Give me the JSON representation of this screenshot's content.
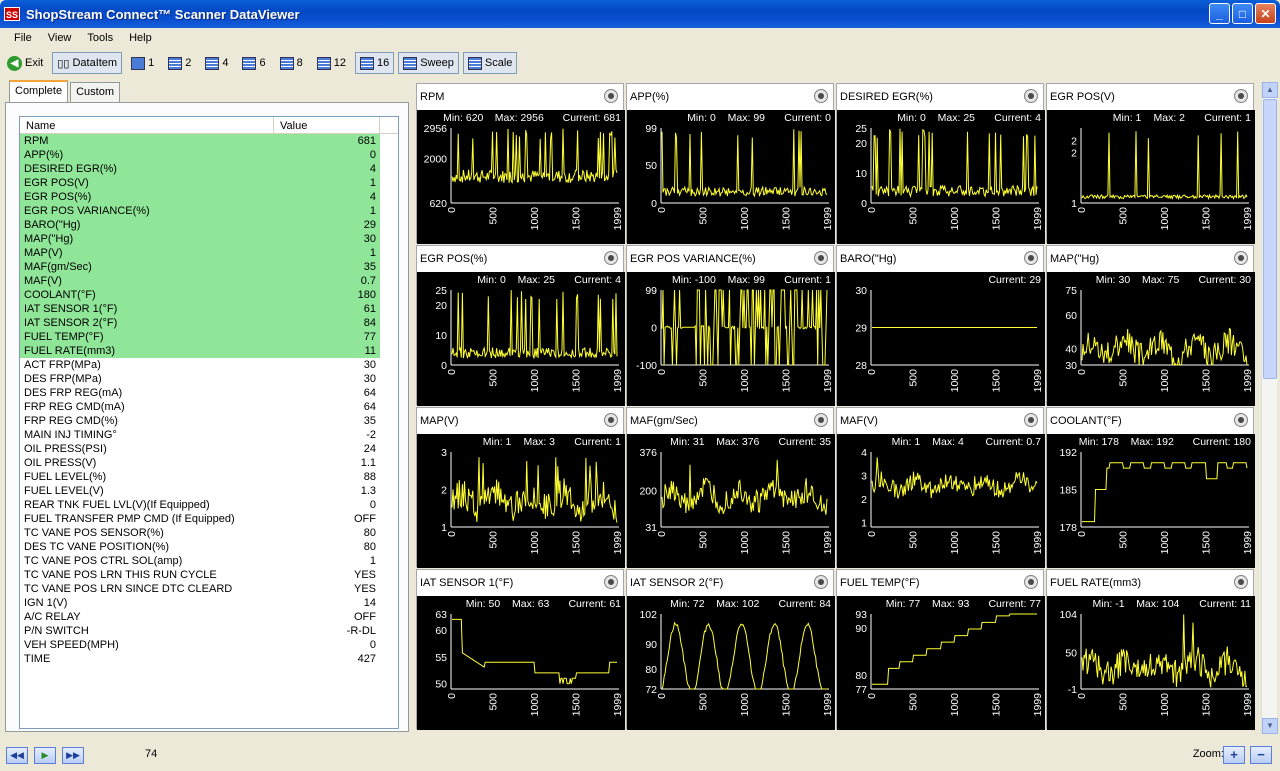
{
  "window": {
    "title": "ShopStream Connect™ Scanner DataViewer",
    "logo_text": "SS"
  },
  "menu": [
    "File",
    "View",
    "Tools",
    "Help"
  ],
  "toolbar": {
    "exit": "Exit",
    "dataitem": "DataItem",
    "layouts": [
      "1",
      "2",
      "4",
      "6",
      "8",
      "12",
      "16"
    ],
    "sweep": "Sweep",
    "scale": "Scale"
  },
  "tabs": [
    "Complete",
    "Custom"
  ],
  "list": {
    "col_name": "Name",
    "col_value": "Value",
    "rows": [
      {
        "name": "RPM",
        "value": "681",
        "hl": true
      },
      {
        "name": "APP(%)",
        "value": "0",
        "hl": true
      },
      {
        "name": "DESIRED EGR(%)",
        "value": "4",
        "hl": true
      },
      {
        "name": "EGR POS(V)",
        "value": "1",
        "hl": true
      },
      {
        "name": "EGR POS(%)",
        "value": "4",
        "hl": true
      },
      {
        "name": "EGR POS VARIANCE(%)",
        "value": "1",
        "hl": true
      },
      {
        "name": "BARO(\"Hg)",
        "value": "29",
        "hl": true
      },
      {
        "name": "MAP(\"Hg)",
        "value": "30",
        "hl": true
      },
      {
        "name": "MAP(V)",
        "value": "1",
        "hl": true
      },
      {
        "name": "MAF(gm/Sec)",
        "value": "35",
        "hl": true
      },
      {
        "name": "MAF(V)",
        "value": "0.7",
        "hl": true
      },
      {
        "name": "COOLANT(°F)",
        "value": "180",
        "hl": true
      },
      {
        "name": "IAT SENSOR 1(°F)",
        "value": "61",
        "hl": true
      },
      {
        "name": "IAT SENSOR 2(°F)",
        "value": "84",
        "hl": true
      },
      {
        "name": "FUEL TEMP(°F)",
        "value": "77",
        "hl": true
      },
      {
        "name": "FUEL RATE(mm3)",
        "value": "11",
        "hl": true
      },
      {
        "name": "ACT FRP(MPa)",
        "value": "30",
        "hl": false
      },
      {
        "name": "DES FRP(MPa)",
        "value": "30",
        "hl": false
      },
      {
        "name": "DES FRP REG(mA)",
        "value": "64",
        "hl": false
      },
      {
        "name": "FRP REG CMD(mA)",
        "value": "64",
        "hl": false
      },
      {
        "name": "FRP REG CMD(%)",
        "value": "35",
        "hl": false
      },
      {
        "name": "MAIN INJ TIMING°",
        "value": "-2",
        "hl": false
      },
      {
        "name": "OIL PRESS(PSI)",
        "value": "24",
        "hl": false
      },
      {
        "name": "OIL PRESS(V)",
        "value": "1.1",
        "hl": false
      },
      {
        "name": "FUEL LEVEL(%)",
        "value": "88",
        "hl": false
      },
      {
        "name": "FUEL LEVEL(V)",
        "value": "1.3",
        "hl": false
      },
      {
        "name": "REAR TNK FUEL LVL(V)(If Equipped)",
        "value": "0",
        "hl": false
      },
      {
        "name": "FUEL TRANSFER PMP CMD (If Equipped)",
        "value": "OFF",
        "hl": false
      },
      {
        "name": "TC VANE POS SENSOR(%)",
        "value": "80",
        "hl": false
      },
      {
        "name": "DES TC VANE POSITION(%)",
        "value": "80",
        "hl": false
      },
      {
        "name": "TC VANE POS CTRL SOL(amp)",
        "value": "1",
        "hl": false
      },
      {
        "name": "TC VANE POS LRN THIS RUN CYCLE",
        "value": "YES",
        "hl": false
      },
      {
        "name": "TC VANE POS LRN SINCE DTC CLEARD",
        "value": "YES",
        "hl": false
      },
      {
        "name": "IGN 1(V)",
        "value": "14",
        "hl": false
      },
      {
        "name": "A/C RELAY",
        "value": "OFF",
        "hl": false
      },
      {
        "name": "P/N SWITCH",
        "value": "-R-DL",
        "hl": false
      },
      {
        "name": "VEH SPEED(MPH)",
        "value": "0",
        "hl": false
      },
      {
        "name": "TIME",
        "value": "427",
        "hl": false
      }
    ]
  },
  "chart_data": [
    {
      "type": "line",
      "title": "RPM",
      "min": "620",
      "max": "2956",
      "current": "681",
      "yticks": [
        "2956",
        "2000",
        "620"
      ],
      "ylim": [
        620,
        2956
      ],
      "xticks": [
        "0",
        "500",
        "1000",
        "1500",
        "1999"
      ],
      "style": "spiky",
      "base": 1450,
      "amp": 700,
      "spikes": 9
    },
    {
      "type": "line",
      "title": "APP(%)",
      "min": "0",
      "max": "99",
      "current": "0",
      "yticks": [
        "99",
        "50",
        "0"
      ],
      "ylim": [
        0,
        99
      ],
      "xticks": [
        "0",
        "500",
        "1000",
        "1500",
        "1999"
      ],
      "style": "spiky",
      "base": 15,
      "amp": 20,
      "spikes": 8
    },
    {
      "type": "line",
      "title": "DESIRED EGR(%)",
      "min": "0",
      "max": "25",
      "current": "4",
      "yticks": [
        "25",
        "20",
        "10",
        "0"
      ],
      "ylim": [
        0,
        25
      ],
      "xticks": [
        "0",
        "500",
        "1000",
        "1500",
        "1999"
      ],
      "style": "spiky",
      "base": 4,
      "amp": 6,
      "spikes": 10
    },
    {
      "type": "line",
      "title": "EGR POS(V)",
      "min": "1",
      "max": "2",
      "current": "1",
      "yticks": [
        "2",
        "2",
        "1"
      ],
      "ylim": [
        1,
        2.2
      ],
      "xticks": [
        "0",
        "500",
        "1000",
        "1500",
        "1999"
      ],
      "style": "spiky",
      "base": 1.1,
      "amp": 0.1,
      "spikes": 6
    },
    {
      "type": "line",
      "title": "EGR POS(%)",
      "min": "0",
      "max": "25",
      "current": "4",
      "yticks": [
        "25",
        "20",
        "10",
        "0"
      ],
      "ylim": [
        0,
        25
      ],
      "xticks": [
        "0",
        "500",
        "1000",
        "1500",
        "1999"
      ],
      "style": "spiky",
      "base": 4,
      "amp": 6,
      "spikes": 10
    },
    {
      "type": "line",
      "title": "EGR POS VARIANCE(%)",
      "min": "-100",
      "max": "99",
      "current": "1",
      "yticks": [
        "99",
        "0",
        "-100"
      ],
      "ylim": [
        -100,
        99
      ],
      "xticks": [
        "0",
        "500",
        "1000",
        "1500",
        "1999"
      ],
      "style": "bursty",
      "base": 0,
      "amp": 99,
      "spikes": 30
    },
    {
      "type": "line",
      "title": "BARO(\"Hg)",
      "min": "",
      "max": "",
      "current": "29",
      "yticks": [
        "30",
        "29",
        "28"
      ],
      "ylim": [
        28,
        30
      ],
      "xticks": [
        "0",
        "500",
        "1000",
        "1500",
        "1999"
      ],
      "style": "flat",
      "base": 29,
      "amp": 0,
      "spikes": 0
    },
    {
      "type": "line",
      "title": "MAP(\"Hg)",
      "min": "30",
      "max": "75",
      "current": "30",
      "yticks": [
        "75",
        "60",
        "40",
        "30"
      ],
      "ylim": [
        30,
        75
      ],
      "xticks": [
        "0",
        "500",
        "1000",
        "1500",
        "1999"
      ],
      "style": "noisy",
      "base": 40,
      "amp": 8,
      "spikes": 3
    },
    {
      "type": "line",
      "title": "MAP(V)",
      "min": "1",
      "max": "3",
      "current": "1",
      "yticks": [
        "3",
        "2",
        "1"
      ],
      "ylim": [
        1,
        3
      ],
      "xticks": [
        "0",
        "500",
        "1000",
        "1500",
        "1999"
      ],
      "style": "noisy",
      "base": 1.7,
      "amp": 0.4,
      "spikes": 4
    },
    {
      "type": "line",
      "title": "MAF(gm/Sec)",
      "min": "31",
      "max": "376",
      "current": "35",
      "yticks": [
        "376",
        "200",
        "31"
      ],
      "ylim": [
        31,
        376
      ],
      "xticks": [
        "0",
        "500",
        "1000",
        "1500",
        "1999"
      ],
      "style": "noisy",
      "base": 170,
      "amp": 60,
      "spikes": 3
    },
    {
      "type": "line",
      "title": "MAF(V)",
      "min": "1",
      "max": "4",
      "current": "0.7",
      "yticks": [
        "4",
        "3",
        "2",
        "1"
      ],
      "ylim": [
        0.8,
        4
      ],
      "xticks": [
        "0",
        "500",
        "1000",
        "1500",
        "1999"
      ],
      "style": "noisy",
      "base": 2.6,
      "amp": 0.4,
      "spikes": 2
    },
    {
      "type": "line",
      "title": "COOLANT(°F)",
      "min": "178",
      "max": "192",
      "current": "180",
      "yticks": [
        "192",
        "185",
        "178"
      ],
      "ylim": [
        178,
        192
      ],
      "xticks": [
        "0",
        "500",
        "1000",
        "1500",
        "1999"
      ],
      "style": "step",
      "base": 188,
      "amp": 2,
      "spikes": 0
    },
    {
      "type": "line",
      "title": "IAT SENSOR 1(°F)",
      "min": "50",
      "max": "63",
      "current": "61",
      "yticks": [
        "63",
        "60",
        "55",
        "50"
      ],
      "ylim": [
        49,
        63
      ],
      "xticks": [
        "0",
        "500",
        "1000",
        "1500",
        "1999"
      ],
      "style": "decay",
      "base": 52,
      "amp": 1,
      "spikes": 0
    },
    {
      "type": "line",
      "title": "IAT SENSOR 2(°F)",
      "min": "72",
      "max": "102",
      "current": "84",
      "yticks": [
        "102",
        "90",
        "80",
        "72"
      ],
      "ylim": [
        72,
        102
      ],
      "xticks": [
        "0",
        "500",
        "1000",
        "1500",
        "1999"
      ],
      "style": "wave",
      "base": 84,
      "amp": 14,
      "spikes": 0
    },
    {
      "type": "line",
      "title": "FUEL TEMP(°F)",
      "min": "77",
      "max": "93",
      "current": "77",
      "yticks": [
        "93",
        "90",
        "80",
        "77"
      ],
      "ylim": [
        77,
        93
      ],
      "xticks": [
        "0",
        "500",
        "1000",
        "1500",
        "1999"
      ],
      "style": "rise",
      "base": 77,
      "amp": 16,
      "spikes": 0
    },
    {
      "type": "line",
      "title": "FUEL RATE(mm3)",
      "min": "-1",
      "max": "104",
      "current": "11",
      "yticks": [
        "104",
        "50",
        "-1"
      ],
      "ylim": [
        -1,
        104
      ],
      "xticks": [
        "0",
        "500",
        "1000",
        "1500",
        "1999"
      ],
      "style": "noisy",
      "base": 30,
      "amp": 20,
      "spikes": 4
    }
  ],
  "status": {
    "counter": "74",
    "zoom_label": "Zoom:"
  }
}
